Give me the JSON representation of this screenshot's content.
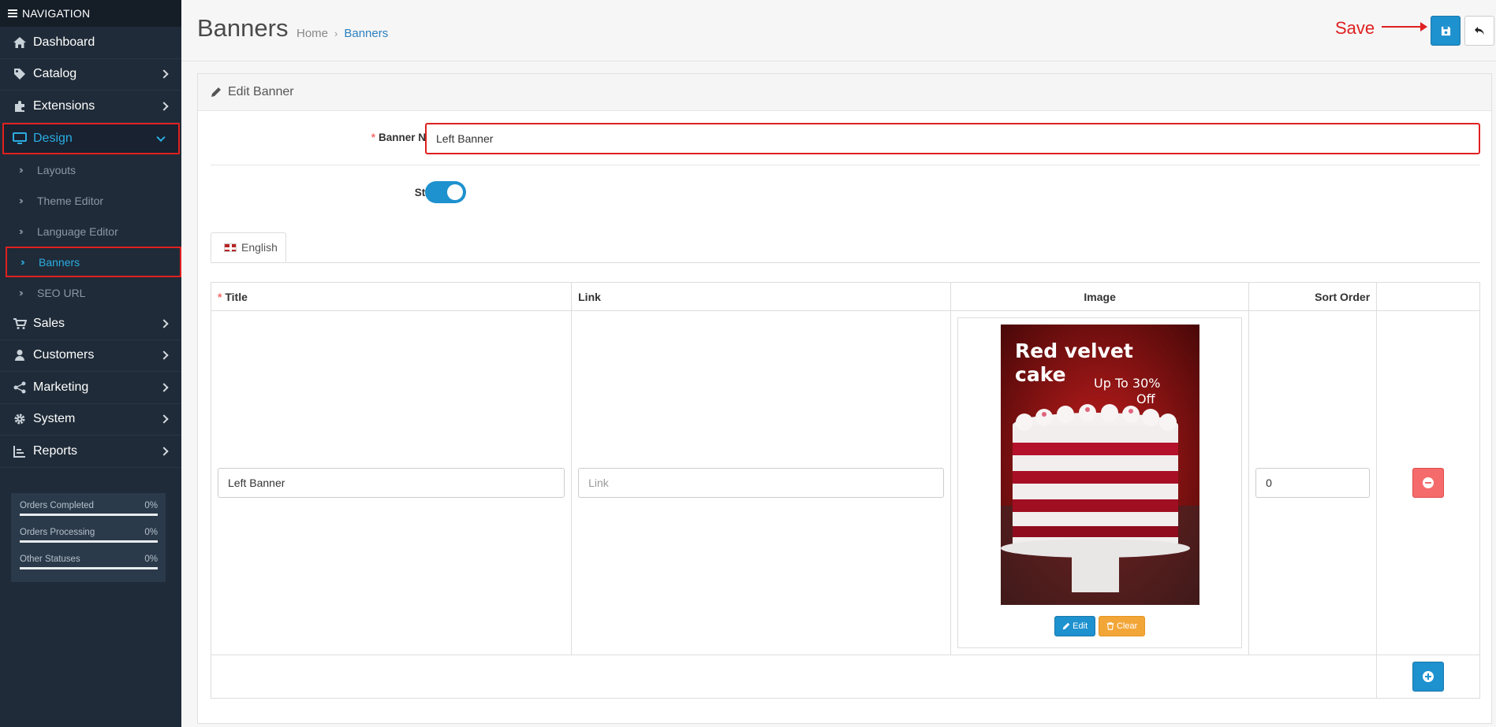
{
  "sidebar": {
    "header": "NAVIGATION",
    "items": [
      {
        "label": "Dashboard",
        "icon": "home-icon"
      },
      {
        "label": "Catalog",
        "icon": "tag-icon"
      },
      {
        "label": "Extensions",
        "icon": "puzzle-icon"
      },
      {
        "label": "Design",
        "icon": "monitor-icon",
        "active": true
      },
      {
        "label": "Sales",
        "icon": "cart-icon"
      },
      {
        "label": "Customers",
        "icon": "user-icon"
      },
      {
        "label": "Marketing",
        "icon": "share-icon"
      },
      {
        "label": "System",
        "icon": "gear-icon"
      },
      {
        "label": "Reports",
        "icon": "bar-chart-icon"
      }
    ],
    "design_sub": [
      {
        "label": "Layouts"
      },
      {
        "label": "Theme Editor"
      },
      {
        "label": "Language Editor"
      },
      {
        "label": "Banners",
        "current": true
      },
      {
        "label": "SEO URL"
      }
    ],
    "stats": [
      {
        "label": "Orders Completed",
        "percent": "0%"
      },
      {
        "label": "Orders Processing",
        "percent": "0%"
      },
      {
        "label": "Other Statuses",
        "percent": "0%"
      }
    ]
  },
  "header": {
    "title": "Banners",
    "breadcrumb": [
      "Home",
      "Banners"
    ],
    "annotation": "Save"
  },
  "panel": {
    "heading": "Edit Banner",
    "banner_name_label": "Banner Name",
    "banner_name_value": "Left Banner",
    "status_label": "Status",
    "status_on": true,
    "tab_label": "English"
  },
  "table": {
    "headers": {
      "title": "Title",
      "link": "Link",
      "image": "Image",
      "sort_order": "Sort Order"
    },
    "row": {
      "title_value": "Left Banner",
      "link_placeholder": "Link",
      "sort_order_value": "0",
      "image_text_1": "Red velvet",
      "image_text_2": "cake",
      "image_text_3": "Up To 30%",
      "image_text_4": "Off",
      "edit_label": "Edit",
      "clear_label": "Clear"
    }
  },
  "colors": {
    "primary": "#1e91cf",
    "danger": "#f56b6b",
    "warning": "#f3a638",
    "sidebar": "#1f2b38",
    "annotation": "#e02020"
  }
}
